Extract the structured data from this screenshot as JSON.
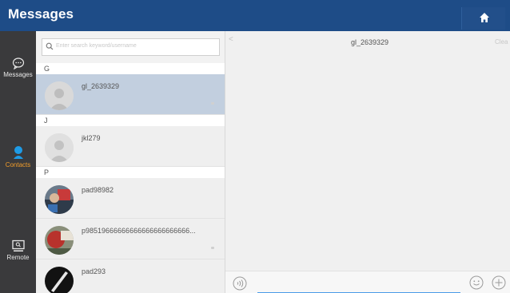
{
  "header": {
    "title": "Messages",
    "home_icon": "home-icon",
    "color": "#1e4c87"
  },
  "rail": {
    "items": [
      {
        "label": "Messages",
        "icon": "chat-bubble-icon"
      },
      {
        "label": "Contacts",
        "icon": "contact-person-icon",
        "active": true,
        "active_color": "#f29d2b"
      },
      {
        "label": "Remote",
        "icon": "remote-screen-icon"
      }
    ]
  },
  "search": {
    "placeholder": "Enter search keyword/username"
  },
  "sections": {
    "g": "G",
    "j": "J",
    "p": "P"
  },
  "contacts": [
    {
      "name": "gl_2639329",
      "avatar": "default-avatar",
      "selected": true
    },
    {
      "name": "jkl279",
      "avatar": "default-avatar"
    },
    {
      "name": "pad98982",
      "avatar": "photo-avatar"
    },
    {
      "name": "p98519666666666666666666666...",
      "avatar": "photo-avatar"
    },
    {
      "name": "pad293",
      "avatar": "photo-avatar"
    }
  ],
  "chat": {
    "back": "<",
    "title": "gl_2639329",
    "clear": "Clea",
    "voice_icon": "voice-icon",
    "emoji_icon": "emoji-icon",
    "plus_icon": "plus-icon"
  }
}
